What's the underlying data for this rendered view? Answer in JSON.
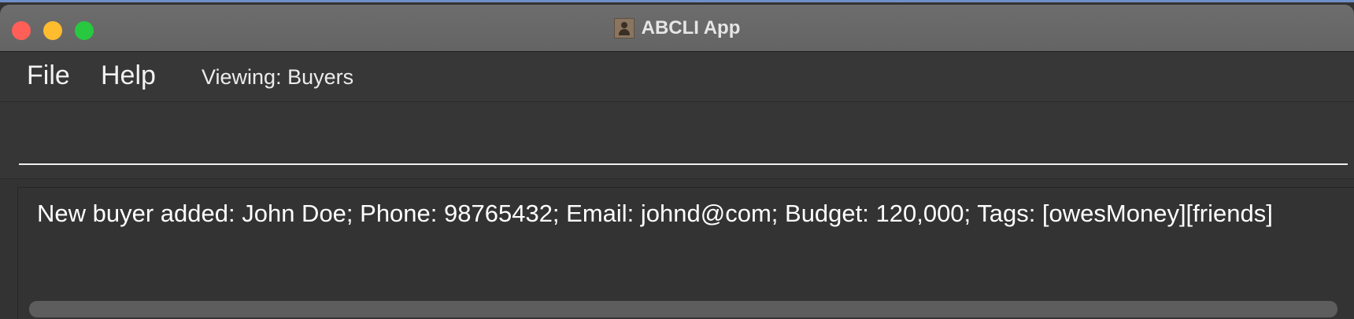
{
  "window": {
    "title": "ABCLI App",
    "app_icon": "address-book-icon"
  },
  "menubar": {
    "file_label": "File",
    "help_label": "Help",
    "viewing_label": "Viewing: Buyers"
  },
  "command_box": {
    "value": "",
    "placeholder": ""
  },
  "result_display": {
    "text": "New buyer added: John Doe; Phone: 98765432; Email: johnd@com; Budget: 120,000; Tags: [owesMoney][friends]"
  }
}
